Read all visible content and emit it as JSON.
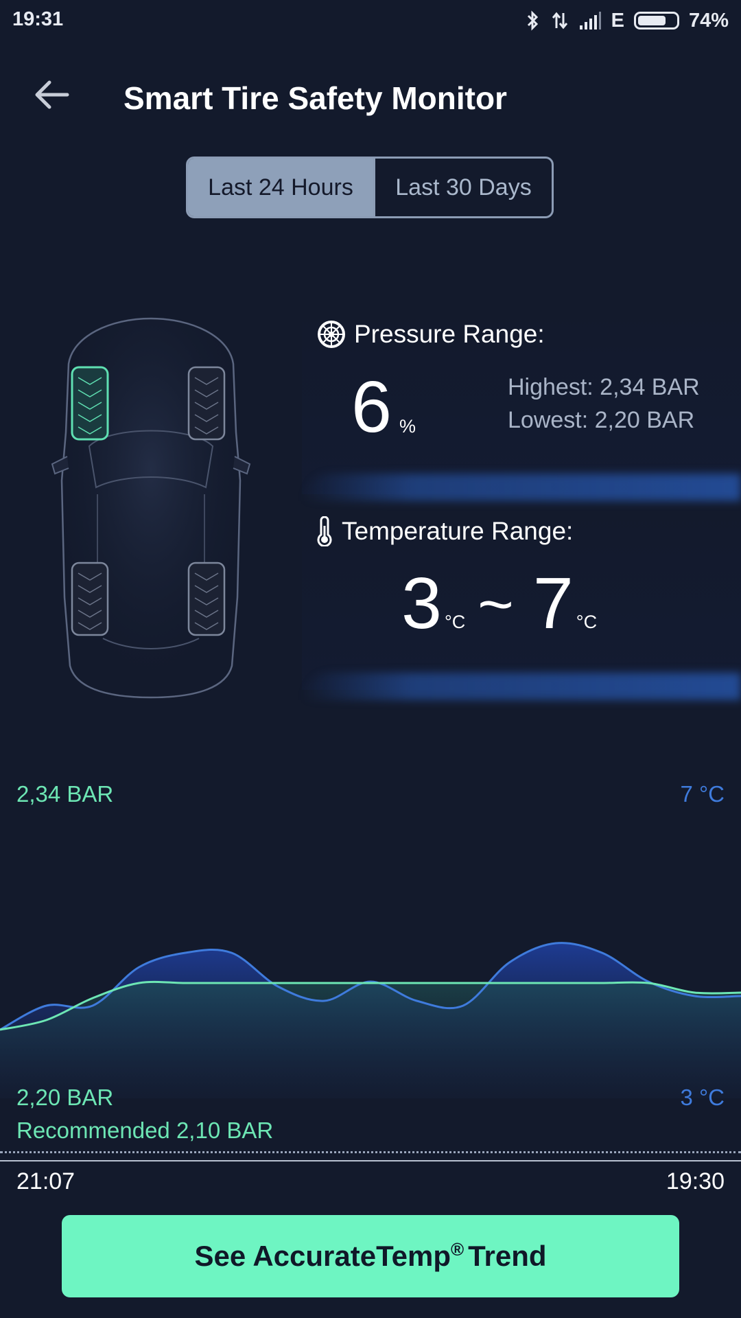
{
  "status_bar": {
    "time": "19:31",
    "network": "E",
    "battery_percent": "74%",
    "battery_level": 0.74
  },
  "header": {
    "title": "Smart Tire Safety Monitor"
  },
  "tabs": [
    {
      "label": "Last 24 Hours",
      "active": true
    },
    {
      "label": "Last 30 Days",
      "active": false
    }
  ],
  "pressure": {
    "label": "Pressure Range:",
    "value": "6",
    "unit": "%",
    "highest": "Highest: 2,34 BAR",
    "lowest": "Lowest: 2,20 BAR"
  },
  "temperature": {
    "label": "Temperature Range:",
    "min": "3",
    "max": "7",
    "unit": "°C",
    "separator": "~"
  },
  "chart": {
    "pressure_top": "2,34 BAR",
    "pressure_bottom": "2,20 BAR",
    "temp_top": "7 °C",
    "temp_bottom": "3 °C",
    "recommended": "Recommended 2,10 BAR",
    "time_start": "21:07",
    "time_end": "19:30"
  },
  "chart_data": {
    "type": "area",
    "x_range": [
      "21:07",
      "19:30"
    ],
    "series": [
      {
        "color": "#3f7bdc",
        "ylim": [
          3,
          7
        ],
        "values": [
          3.0,
          3.5,
          3.5,
          4.3,
          4.6,
          4.6,
          3.9,
          3.6,
          4.0,
          3.6,
          3.5,
          4.4,
          4.8,
          4.6,
          4.0,
          3.7,
          3.7
        ]
      },
      {
        "color": "#6de6b4",
        "ylim": [
          2.2,
          2.34
        ],
        "values": [
          2.2,
          2.207,
          2.223,
          2.234,
          2.234,
          2.234,
          2.234,
          2.234,
          2.234,
          2.234,
          2.234,
          2.234,
          2.234,
          2.234,
          2.234,
          2.227,
          2.227
        ]
      }
    ]
  },
  "footer": {
    "button_label": "See AccurateTemp",
    "button_sup": "®",
    "button_label_end": "Trend"
  }
}
